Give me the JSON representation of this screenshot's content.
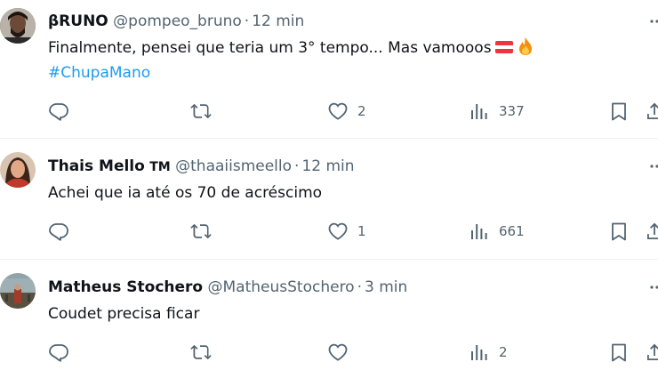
{
  "tweets": [
    {
      "name": "βRUNO",
      "verified_mark": "",
      "handle": "@pompeo_bruno",
      "separator": "·",
      "time": "12 min",
      "text_line1": "Finalmente, pensei que teria um 3° tempo... Mas vamooos",
      "emoji_names": [
        "austria-flag-emoji",
        "fire-emoji"
      ],
      "hashtag": "#ChupaMano",
      "reply_count": "",
      "retweet_count": "",
      "like_count": "2",
      "view_count": "337"
    },
    {
      "name": "Thais Mello",
      "verified_mark": "TM",
      "handle": "@thaaiismeello",
      "separator": "·",
      "time": "12 min",
      "text_line1": "Achei que ia até os 70 de acréscimo",
      "reply_count": "",
      "retweet_count": "",
      "like_count": "1",
      "view_count": "661"
    },
    {
      "name": "Matheus Stochero",
      "verified_mark": "",
      "handle": "@MatheusStochero",
      "separator": "·",
      "time": "3 min",
      "text_line1": "Coudet precisa ficar",
      "reply_count": "",
      "retweet_count": "",
      "like_count": "",
      "view_count": "2"
    }
  ],
  "icons": {
    "reply": "reply-icon",
    "retweet": "retweet-icon",
    "like": "heart-icon",
    "views": "views-chart-icon",
    "bookmark": "bookmark-icon",
    "share": "share-icon",
    "more": "more-dots-icon"
  },
  "colors": {
    "text": "#0f1419",
    "secondary": "#536471",
    "hashtag": "#1d9bf0",
    "divider": "#eff3f4"
  }
}
